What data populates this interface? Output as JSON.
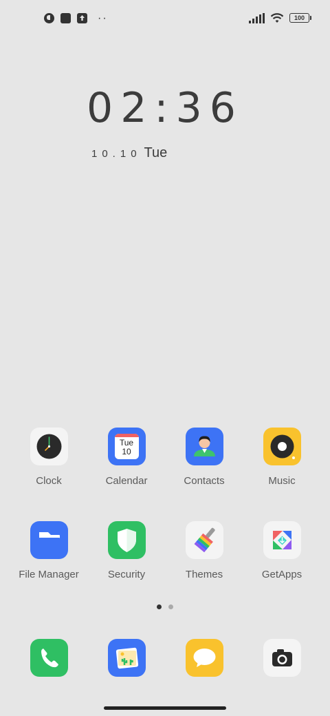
{
  "status_bar": {
    "battery_level": "100",
    "dots": "··"
  },
  "lockscreen": {
    "time": "02:36",
    "date_numeric": "10.10",
    "weekday": "Tue"
  },
  "apps": [
    {
      "label": "Clock",
      "icon": "clock-icon"
    },
    {
      "label": "Calendar",
      "icon": "calendar-icon",
      "cal_day": "Tue",
      "cal_date": "10"
    },
    {
      "label": "Contacts",
      "icon": "contacts-icon"
    },
    {
      "label": "Music",
      "icon": "music-icon"
    },
    {
      "label": "File Manager",
      "icon": "folder-icon"
    },
    {
      "label": "Security",
      "icon": "shield-icon"
    },
    {
      "label": "Themes",
      "icon": "paintbrush-icon"
    },
    {
      "label": "GetApps",
      "icon": "getapps-icon"
    }
  ],
  "dock": [
    {
      "icon": "phone-icon"
    },
    {
      "icon": "gallery-icon"
    },
    {
      "icon": "messages-icon"
    },
    {
      "icon": "camera-icon"
    }
  ],
  "pager": {
    "total": 2,
    "active": 1
  },
  "colors": {
    "background": "#e6e6e6",
    "blue": "#3d73f5",
    "green": "#2fbf63",
    "yellow": "#f9c22d"
  }
}
